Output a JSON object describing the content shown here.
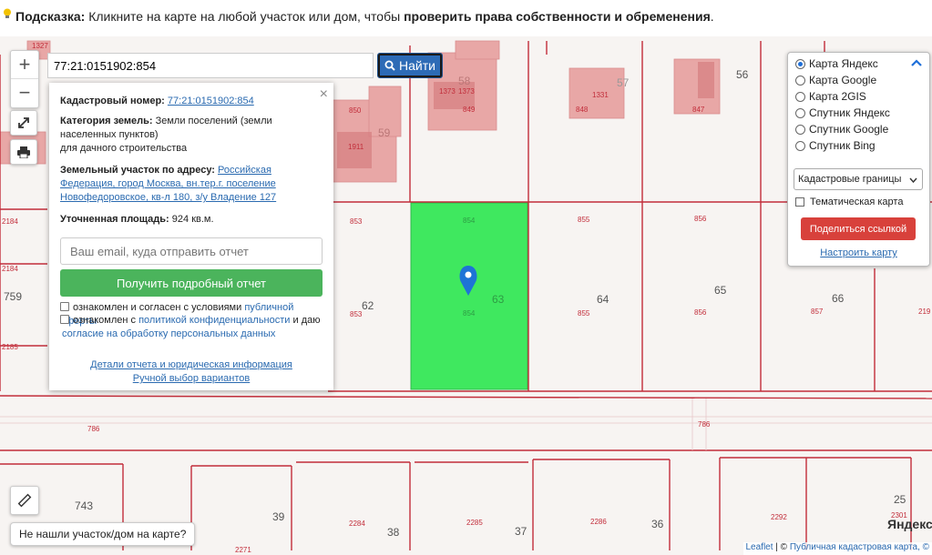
{
  "hint": {
    "label": "Подсказка:",
    "text": "Кликните на карте на любой участок или дом, чтобы",
    "bold_text": "проверить права собственности и обременения",
    "end": "."
  },
  "search": {
    "value": "77:21:0151902:854",
    "button_label": "Найти"
  },
  "zoom": {
    "in": "+",
    "out": "−"
  },
  "popup": {
    "cad_label": "Кадастровый номер:",
    "cad_value": "77:21:0151902:854",
    "cat_label": "Категория земель:",
    "cat_value_1": "Земли поселений (земли",
    "cat_value_2": "населенных пунктов)",
    "cat_value_3": "для дачного строительства",
    "addr_label": "Земельный участок по адресу:",
    "addr_1": "Российская",
    "addr_2": "Федерация, город Москва, вн.тер.г. поселение",
    "addr_3": "Новофедоровское, кв-л 180, з/у Владение 127",
    "area_label": "Уточненная площадь:",
    "area_value": "924 кв.м.",
    "email_placeholder": "Ваш email, куда отправить отчет",
    "get_button": "Получить подробный отчет",
    "agree1_text": "ознакомлен и согласен с условиями",
    "agree1_link": "публичной оферты",
    "agree2_text": "ознакомлен с",
    "agree2_link": "политикой конфиденциальности",
    "agree2_mid": "и даю",
    "agree2_link2": "согласие на обработку персональных данных",
    "details_link": "Детали отчета и юридическая информация",
    "manual_link": "Ручной выбор вариантов",
    "close": "×"
  },
  "layers": {
    "options": [
      {
        "label": "Карта Яндекс",
        "checked": true
      },
      {
        "label": "Карта Google",
        "checked": false
      },
      {
        "label": "Карта 2GIS",
        "checked": false
      },
      {
        "label": "Спутник Яндекс",
        "checked": false
      },
      {
        "label": "Спутник Google",
        "checked": false
      },
      {
        "label": "Спутник Bing",
        "checked": false
      }
    ],
    "select_value": "Кадастровые границы",
    "thematic_label": "Тематическая карта",
    "share_label": "Поделиться ссылкой",
    "config_label": "Настроить карту"
  },
  "not_found": "Не нашли участок/дом на карте?",
  "attribution": {
    "leaflet": "Leaflet",
    "sep": " | © ",
    "pkk": "Публичная кадастровая карта, ©"
  },
  "yandex_logo": "Яндекс",
  "map_labels": {
    "n1327": "1327",
    "n58": "58",
    "n57": "57",
    "n56": "56",
    "n1373a": "1373",
    "n1373b": "1373",
    "n1331": "1331",
    "n850": "850",
    "n849": "849",
    "n848": "848",
    "n847": "847",
    "n59": "59",
    "n1911": "1911",
    "n2184a": "2184",
    "n2184b": "2184",
    "n759": "759",
    "n2185": "2185",
    "n853a": "853",
    "n853b": "853",
    "n854a": "854",
    "n854b": "854",
    "n855a": "855",
    "n855b": "855",
    "n856a": "856",
    "n856b": "856",
    "n857": "857",
    "n219": "219",
    "n62": "62",
    "n63": "63",
    "n64": "64",
    "n65": "65",
    "n66": "66",
    "n786a": "786",
    "n786b": "786",
    "n743": "743",
    "n39": "39",
    "n2284": "2284",
    "n38": "38",
    "n2285": "2285",
    "n37": "37",
    "n2286": "2286",
    "n36": "36",
    "n2292": "2292",
    "n25": "25",
    "n2301": "2301",
    "n2271": "2271"
  },
  "colors": {
    "selected": "#3fe85f",
    "parcel_line": "#c22d3a",
    "building": "#e8a7a6",
    "building_dark": "#d67e80",
    "accent": "#2d6bb6"
  },
  "icons": [
    "lightbulb-icon",
    "fullscreen-icon",
    "printer-icon",
    "ruler-icon",
    "search-icon",
    "map-pin-icon",
    "chevron-up-icon",
    "chevron-down-icon"
  ]
}
